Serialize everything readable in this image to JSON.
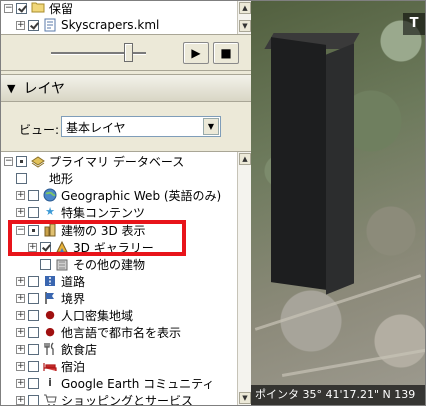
{
  "places": {
    "items": [
      {
        "label": "保留",
        "checked": true,
        "icon": "folder-icon",
        "expanded": true
      },
      {
        "label": "Skyscrapers.kml",
        "checked": true,
        "icon": "kml-file-icon",
        "expanded": false
      }
    ]
  },
  "tour": {
    "play_icon": "▶",
    "stop_icon": "■"
  },
  "layers": {
    "title": "レイヤ",
    "view_label": "ビュー:",
    "view_value": "基本レイヤ"
  },
  "tree": {
    "items": [
      {
        "label": "プライマリ データベース",
        "icon": "database-icon"
      },
      {
        "label": "地形",
        "icon": "terrain-icon"
      },
      {
        "label": "Geographic Web (英語のみ)",
        "icon": "globe-icon"
      },
      {
        "label": "特集コンテンツ",
        "icon": "star-icon"
      },
      {
        "label": "建物の 3D 表示",
        "icon": "building-icon"
      },
      {
        "label": "3D ギャラリー",
        "icon": "gallery-icon"
      },
      {
        "label": "その他の建物",
        "icon": "building-gray-icon"
      },
      {
        "label": "道路",
        "icon": "road-icon"
      },
      {
        "label": "境界",
        "icon": "flag-icon"
      },
      {
        "label": "人口密集地域",
        "icon": "dot-icon"
      },
      {
        "label": "他言語で都市名を表示",
        "icon": "dot-icon"
      },
      {
        "label": "飲食店",
        "icon": "fork-icon"
      },
      {
        "label": "宿泊",
        "icon": "bed-icon"
      },
      {
        "label": "Google Earth コミュニティ",
        "icon": "info-icon"
      },
      {
        "label": "ショッピングとサービス",
        "icon": "cart-icon"
      }
    ]
  },
  "map": {
    "nav_letter": "T",
    "status": "ポインタ 35° 41'17.21\" N 139"
  },
  "colors": {
    "highlight": "#e8141a"
  }
}
